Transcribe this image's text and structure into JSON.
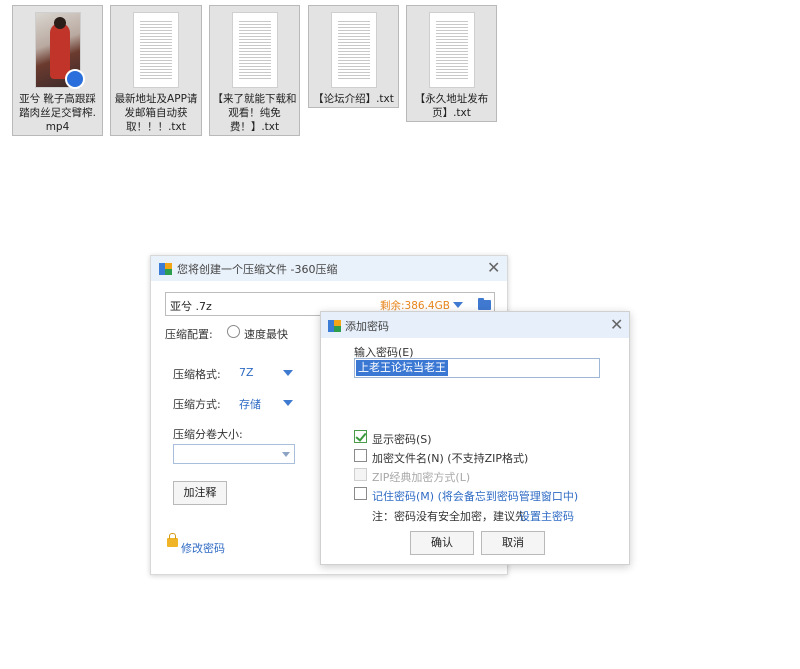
{
  "desktop": {
    "files": [
      {
        "name": "亚兮 靴子高跟踩踏肉丝足交臂榨.mp4",
        "type": "video"
      },
      {
        "name": "最新地址及APP请发邮箱自动获取！！！.txt",
        "type": "text"
      },
      {
        "name": "【来了就能下载和观看！纯免费！】.txt",
        "type": "text"
      },
      {
        "name": "【论坛介绍】.txt",
        "type": "text"
      },
      {
        "name": "【永久地址发布页】.txt",
        "type": "text"
      }
    ]
  },
  "compress_window": {
    "title": "您将创建一个压缩文件 -360压缩",
    "filename": "亚兮 .7z",
    "free_space": "剩余:386.4GB",
    "config_label": "压缩配置:",
    "speed_option": "速度最快",
    "format_label": "压缩格式:",
    "format_value": "7Z",
    "method_label": "压缩方式:",
    "method_value": "存储",
    "volume_label": "压缩分卷大小:",
    "volume_value": "",
    "comment_button": "加注释",
    "change_password": "修改密码"
  },
  "password_dialog": {
    "title": "添加密码",
    "input_label": "输入密码(E)",
    "password_value": "上老王论坛当老王",
    "show_password": {
      "label": "显示密码(S)",
      "checked": true
    },
    "encrypt_filenames": {
      "label": "加密文件名(N) (不支持ZIP格式)",
      "checked": false
    },
    "zip_classic": {
      "label": "ZIP经典加密方式(L)",
      "checked": false,
      "disabled": true
    },
    "remember_password": {
      "label": "记住密码(M) (将会备忘到密码管理窗口中)",
      "checked": false
    },
    "note_prefix": "注：密码没有安全加密，建议先",
    "note_link": "设置主密码",
    "ok_button": "确认",
    "cancel_button": "取消"
  },
  "colors": {
    "accent_blue": "#2f6bc4",
    "free_space_orange": "#e8851b",
    "title_bar": "#e9f1fa",
    "selection": "#3b78d4"
  }
}
